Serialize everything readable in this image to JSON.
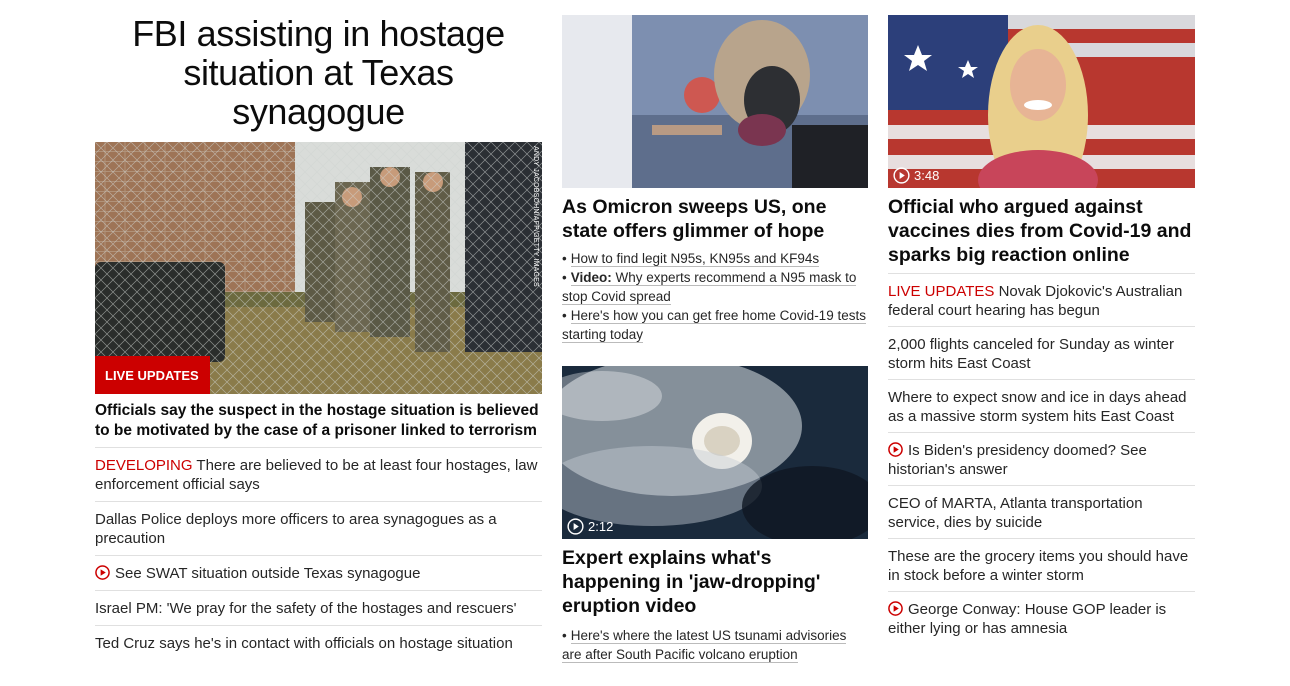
{
  "col1": {
    "headline": "FBI assisting in hostage situation at Texas synagogue",
    "badge": "LIVE UPDATES",
    "photo_credit": "ANDY JACOBSOHN/AFP/GETTY IMAGES",
    "story_title": "Officials say the suspect in the hostage situation is believed to be motivated by the case of a prisoner linked to terrorism",
    "items": [
      {
        "prefix": "DEVELOPING",
        "text": " There are believed to be at least four hostages, law enforcement official says"
      },
      {
        "text": "Dallas Police deploys more officers to area synagogues as a precaution"
      },
      {
        "text": "See SWAT situation outside Texas synagogue",
        "icon": "play-icon"
      },
      {
        "text": "Israel PM: 'We pray for the safety of the hostages and rescuers'"
      },
      {
        "text": "Ted Cruz says he's in contact with officials on hostage situation"
      }
    ]
  },
  "col2": {
    "story1": {
      "title": "As Omicron sweeps US, one state offers glimmer of hope",
      "bullets": [
        {
          "text": "How to find legit N95s, KN95s and KF94s"
        },
        {
          "bold": "Video:",
          "text": " Why experts recommend a N95 mask to stop Covid spread"
        },
        {
          "text": "Here's how you can get free home Covid-19 tests starting today"
        }
      ]
    },
    "story2": {
      "duration": "2:12",
      "title": "Expert explains what's happening in 'jaw-dropping' eruption video",
      "bullets": [
        {
          "text": "Here's where the latest US tsunami advisories are after South Pacific volcano eruption"
        }
      ]
    }
  },
  "col3": {
    "duration": "3:48",
    "title": "Official who argued against vaccines dies from Covid-19 and sparks big reaction online",
    "items": [
      {
        "prefix": "LIVE UPDATES",
        "text": " Novak Djokovic's Australian federal court hearing has begun"
      },
      {
        "text": "2,000 flights canceled for Sunday as winter storm hits East Coast"
      },
      {
        "text": "Where to expect snow and ice in days ahead as a massive storm system hits East Coast"
      },
      {
        "text": "Is Biden's presidency doomed? See historian's answer",
        "icon": "play-icon"
      },
      {
        "text": "CEO of MARTA, Atlanta transportation service, dies by suicide"
      },
      {
        "text": "These are the grocery items you should have in stock before a winter storm"
      },
      {
        "text": "George Conway: House GOP leader is either lying or has amnesia",
        "icon": "play-icon"
      }
    ]
  },
  "colors": {
    "accent_red": "#cc0000",
    "text": "#262626",
    "divider": "#e0e0e0"
  }
}
